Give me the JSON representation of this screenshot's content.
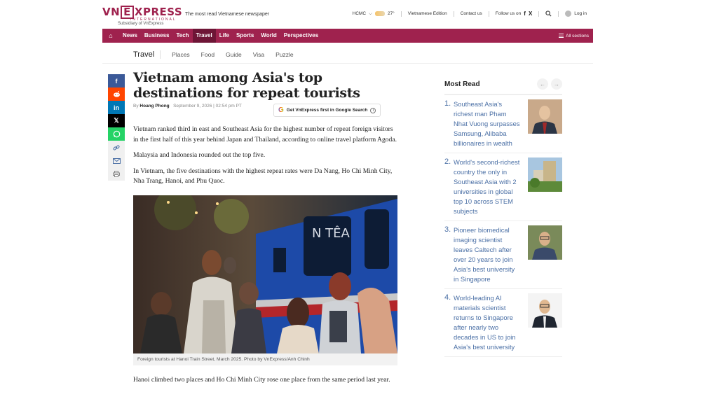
{
  "header": {
    "logo_prefix": "VN",
    "logo_box": "E",
    "logo_suffix": "XPRESS",
    "logo_intl": "INTERNATIONAL",
    "logo_sub": "Subsidiary of VnExpress",
    "tagline": "The most read Vietnamese newspaper",
    "city": "HCMC",
    "temperature": "27°",
    "edition": "Vietnamese Edition",
    "contact": "Contact us",
    "follow": "Follow us on",
    "login": "Log in"
  },
  "nav": {
    "items": [
      "News",
      "Business",
      "Tech",
      "Travel",
      "Life",
      "Sports",
      "World",
      "Perspectives"
    ],
    "active": "Travel",
    "all_sections": "All sections"
  },
  "subnav": {
    "category": "Travel",
    "items": [
      "Places",
      "Food",
      "Guide",
      "Visa",
      "Puzzle"
    ]
  },
  "article": {
    "headline": "Vietnam among Asia's top destinations for repeat tourists",
    "by": "By",
    "author": "Hoang Phong",
    "date": "September 9, 2026 | 02:54 pm PT",
    "google_button": "Get VnExpress first in Google Search",
    "paragraphs": [
      "Vietnam ranked third in east and Southeast Asia for the highest number of repeat foreign visitors in the first half of this year behind Japan and Thailand, according to online travel platform Agoda.",
      "Malaysia and Indonesia rounded out the top five.",
      "In Vietnam, the five destinations with the highest repeat rates were Da Nang, Ho Chi Minh City, Nha Trang, Hanoi, and Phu Quoc.",
      "Hanoi climbed two places and Ho Chi Minh City rose one place from the same period last year."
    ],
    "train_text": "N TÊA",
    "caption": "Foreign tourists at Hanoi Train Street, March 2025. Photo by VnExpress/Anh Chinh"
  },
  "sidebar": {
    "title": "Most Read",
    "items": [
      {
        "num": "1.",
        "text": "Southeast Asia's richest man Pham Nhat Vuong surpasses Samsung, Alibaba billionaires in wealth"
      },
      {
        "num": "2.",
        "text": "World's second-richest country the only in Southeast Asia with 2 universities in global top 10 across STEM subjects"
      },
      {
        "num": "3.",
        "text": "Pioneer biomedical imaging scientist leaves Caltech after over 20 years to join Asia's best university in Singapore"
      },
      {
        "num": "4.",
        "text": "World-leading AI materials scientist returns to Singapore after nearly two decades in US to join Asia's best university"
      }
    ]
  },
  "colors": {
    "brand": "#9f224e",
    "link": "#4a6fa5"
  }
}
